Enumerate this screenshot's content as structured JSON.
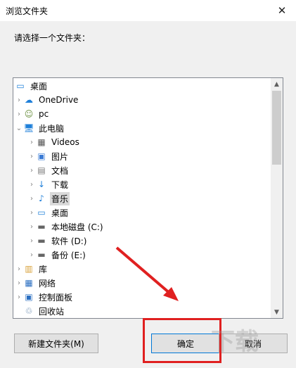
{
  "window": {
    "title": "浏览文件夹",
    "close_glyph": "✕"
  },
  "prompt": "请选择一个文件夹：",
  "tree": [
    {
      "label": "桌面",
      "icon": "desktop-icon",
      "chev": "",
      "indent": 0
    },
    {
      "label": "OneDrive",
      "icon": "cloud-icon",
      "chev": "›",
      "indent": 1
    },
    {
      "label": "pc",
      "icon": "user-icon",
      "chev": "›",
      "indent": 1
    },
    {
      "label": "此电脑",
      "icon": "computer-icon",
      "chev": "⌄",
      "indent": 1
    },
    {
      "label": "Videos",
      "icon": "video-folder-icon",
      "chev": "›",
      "indent": 2
    },
    {
      "label": "图片",
      "icon": "pictures-folder-icon",
      "chev": "›",
      "indent": 2
    },
    {
      "label": "文档",
      "icon": "documents-folder-icon",
      "chev": "›",
      "indent": 2
    },
    {
      "label": "下载",
      "icon": "download-folder-icon",
      "chev": "›",
      "indent": 2
    },
    {
      "label": "音乐",
      "icon": "music-folder-icon",
      "chev": "›",
      "indent": 2,
      "selected": true
    },
    {
      "label": "桌面",
      "icon": "desktop-icon",
      "chev": "›",
      "indent": 2
    },
    {
      "label": "本地磁盘 (C:)",
      "icon": "system-drive-icon",
      "chev": "›",
      "indent": 2
    },
    {
      "label": "软件 (D:)",
      "icon": "drive-icon",
      "chev": "›",
      "indent": 2
    },
    {
      "label": "备份 (E:)",
      "icon": "drive-icon",
      "chev": "›",
      "indent": 2
    },
    {
      "label": "库",
      "icon": "library-icon",
      "chev": "›",
      "indent": 1
    },
    {
      "label": "网络",
      "icon": "network-icon",
      "chev": "›",
      "indent": 1
    },
    {
      "label": "控制面板",
      "icon": "control-panel-icon",
      "chev": "›",
      "indent": 1
    },
    {
      "label": "回收站",
      "icon": "recycle-bin-icon",
      "chev": "",
      "indent": 1
    }
  ],
  "buttons": {
    "new_folder": "新建文件夹(M)",
    "ok": "确定",
    "cancel": "取消"
  },
  "colors": {
    "highlight": "#e02020",
    "accent": "#0078d7"
  }
}
